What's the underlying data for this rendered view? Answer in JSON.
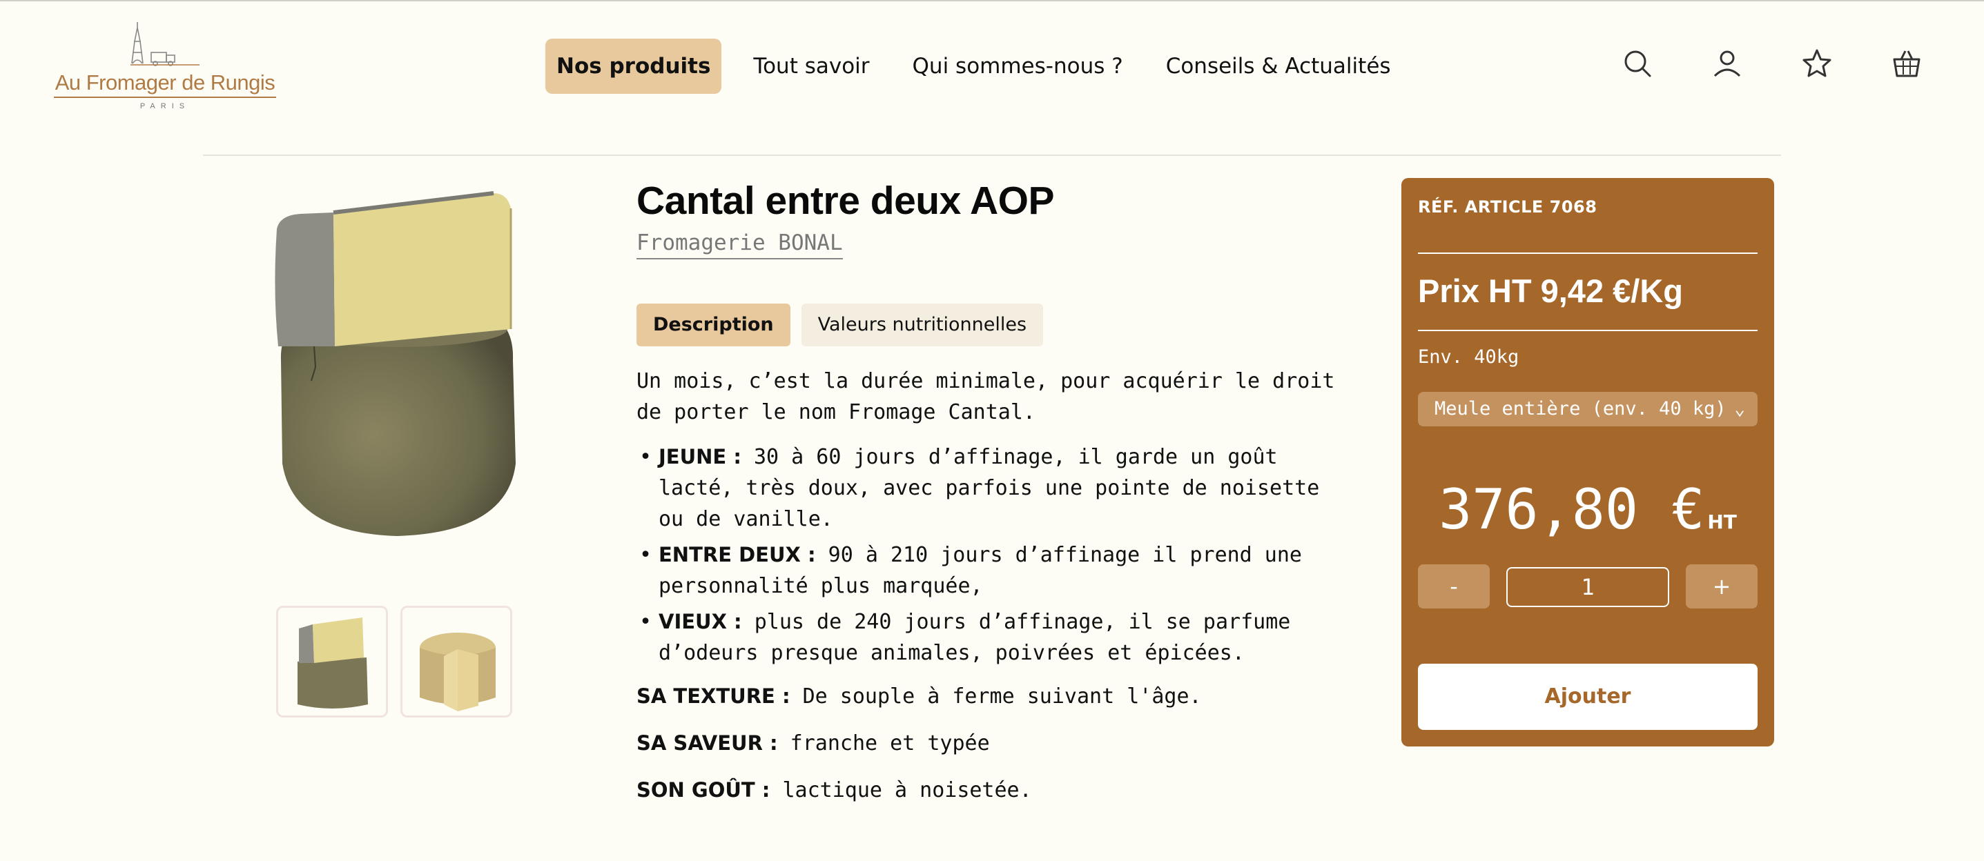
{
  "header": {
    "logo": {
      "name": "Au Fromager de Rungis",
      "sub": "PARIS"
    },
    "nav": [
      {
        "label": "Nos produits",
        "active": true
      },
      {
        "label": "Tout savoir",
        "active": false
      },
      {
        "label": "Qui sommes-nous ?",
        "active": false
      },
      {
        "label": "Conseils & Actualités",
        "active": false
      }
    ],
    "icons": [
      "search-icon",
      "user-icon",
      "star-icon",
      "basket-icon"
    ]
  },
  "product": {
    "title": "Cantal entre deux AOP",
    "producer": "Fromagerie BONAL",
    "images": [
      "cheese-wheel-with-slice",
      "cheese-wheel-cut"
    ],
    "tabs": [
      {
        "label": "Description",
        "active": true
      },
      {
        "label": "Valeurs nutritionnelles",
        "active": false
      }
    ],
    "description": {
      "intro": "Un mois, c’est la durée minimale, pour acquérir le droit de porter le nom Fromage Cantal.",
      "bullets": [
        {
          "term": "JEUNE :",
          "text": " 30 à 60 jours d’affinage, il garde un goût lacté, très doux, avec parfois une pointe de noisette ou de vanille."
        },
        {
          "term": "ENTRE DEUX :",
          "text": " 90 à 210 jours d’affinage il prend une personnalité plus marquée,"
        },
        {
          "term": "VIEUX :",
          "text": " plus de 240 jours d’affinage, il se parfume d’odeurs presque animales, poivrées et épicées."
        }
      ],
      "texture": {
        "term": "SA TEXTURE :",
        "text": " De souple à ferme suivant l'âge."
      },
      "saveur": {
        "term": "SA SAVEUR :",
        "text": " franche et typée"
      },
      "gout": {
        "term": "SON GOÛT :",
        "text": " lactique à noisetée."
      }
    }
  },
  "purchase": {
    "ref": "RÉF. ARTICLE 7068",
    "price_per_kg": "Prix HT 9,42 €/Kg",
    "weight": "Env. 40kg",
    "format_selected": "Meule entière (env. 40 kg)",
    "total": "376,80 €",
    "total_unit": "HT",
    "minus_label": "-",
    "plus_label": "+",
    "quantity": "1",
    "add_label": "Ajouter"
  },
  "colors": {
    "accent": "#e8c99e",
    "panel": "#a6682a",
    "panel_light": "#c3925e",
    "background": "#fdfdf6"
  }
}
